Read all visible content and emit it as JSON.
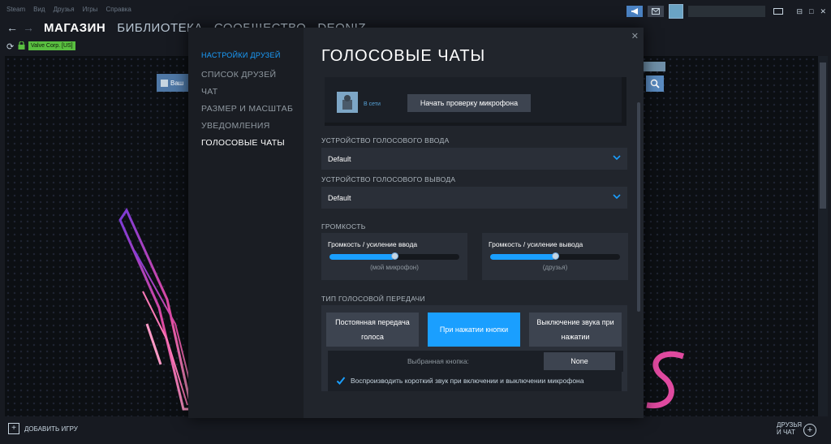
{
  "menu": [
    "Steam",
    "Вид",
    "Друзья",
    "Игры",
    "Справка"
  ],
  "window_controls": [
    "⊟",
    "□",
    "✕"
  ],
  "nav": {
    "back": "←",
    "forward": "→",
    "tabs": [
      "МАГАЗИН",
      "БИБЛИОТЕКА",
      "СООБЩЕСТВО",
      "DEONIZ"
    ]
  },
  "urlbar": {
    "reload": "⟳",
    "lock": "🔒",
    "cert": "Valve Corp. [US]"
  },
  "store": {
    "button_label": "Ваш"
  },
  "bottom": {
    "add_game": "ДОБАВИТЬ ИГРУ",
    "friends_line1": "ДРУЗЬЯ",
    "friends_line2": "И ЧАТ"
  },
  "dialog": {
    "close": "✕",
    "sidebar": {
      "heading": "НАСТРОЙКИ ДРУЗЕЙ",
      "items": [
        "СПИСОК ДРУЗЕЙ",
        "ЧАТ",
        "РАЗМЕР И МАСШТАБ",
        "УВЕДОМЛЕНИЯ",
        "ГОЛОСОВЫЕ ЧАТЫ"
      ],
      "active_index": 4
    },
    "title": "ГОЛОСОВЫЕ ЧАТЫ",
    "mic": {
      "status": "В сети",
      "test_button": "Начать проверку микрофона"
    },
    "input_device": {
      "label": "УСТРОЙСТВО ГОЛОСОВОГО ВВОДА",
      "value": "Default"
    },
    "output_device": {
      "label": "УСТРОЙСТВО ГОЛОСОВОГО ВЫВОДА",
      "value": "Default"
    },
    "volume": {
      "label": "ГРОМКОСТЬ",
      "input": {
        "title": "Громкость / усиление ввода",
        "caption": "(мой микрофон)",
        "level": 0.5
      },
      "output": {
        "title": "Громкость / усиление вывода",
        "caption": "(друзья)",
        "level": 0.5
      }
    },
    "transmission": {
      "label": "ТИП ГОЛОСОВОЙ ПЕРЕДАЧИ",
      "options": [
        {
          "line1": "Постоянная передача",
          "line2": "голоса"
        },
        {
          "line1": "При нажатии кнопки",
          "line2": ""
        },
        {
          "line1": "Выключение звука при",
          "line2": "нажатии"
        }
      ],
      "selected_index": 1,
      "key_label": "Выбранная кнопка:",
      "key_value": "None",
      "sound_checkbox": "Воспроизводить короткий звук при включении и выключении микрофона",
      "sound_checked": true
    }
  },
  "colors": {
    "accent": "#1a9fff",
    "background": "#171a21",
    "panel": "#21252c",
    "cert_green": "#59bf40"
  }
}
